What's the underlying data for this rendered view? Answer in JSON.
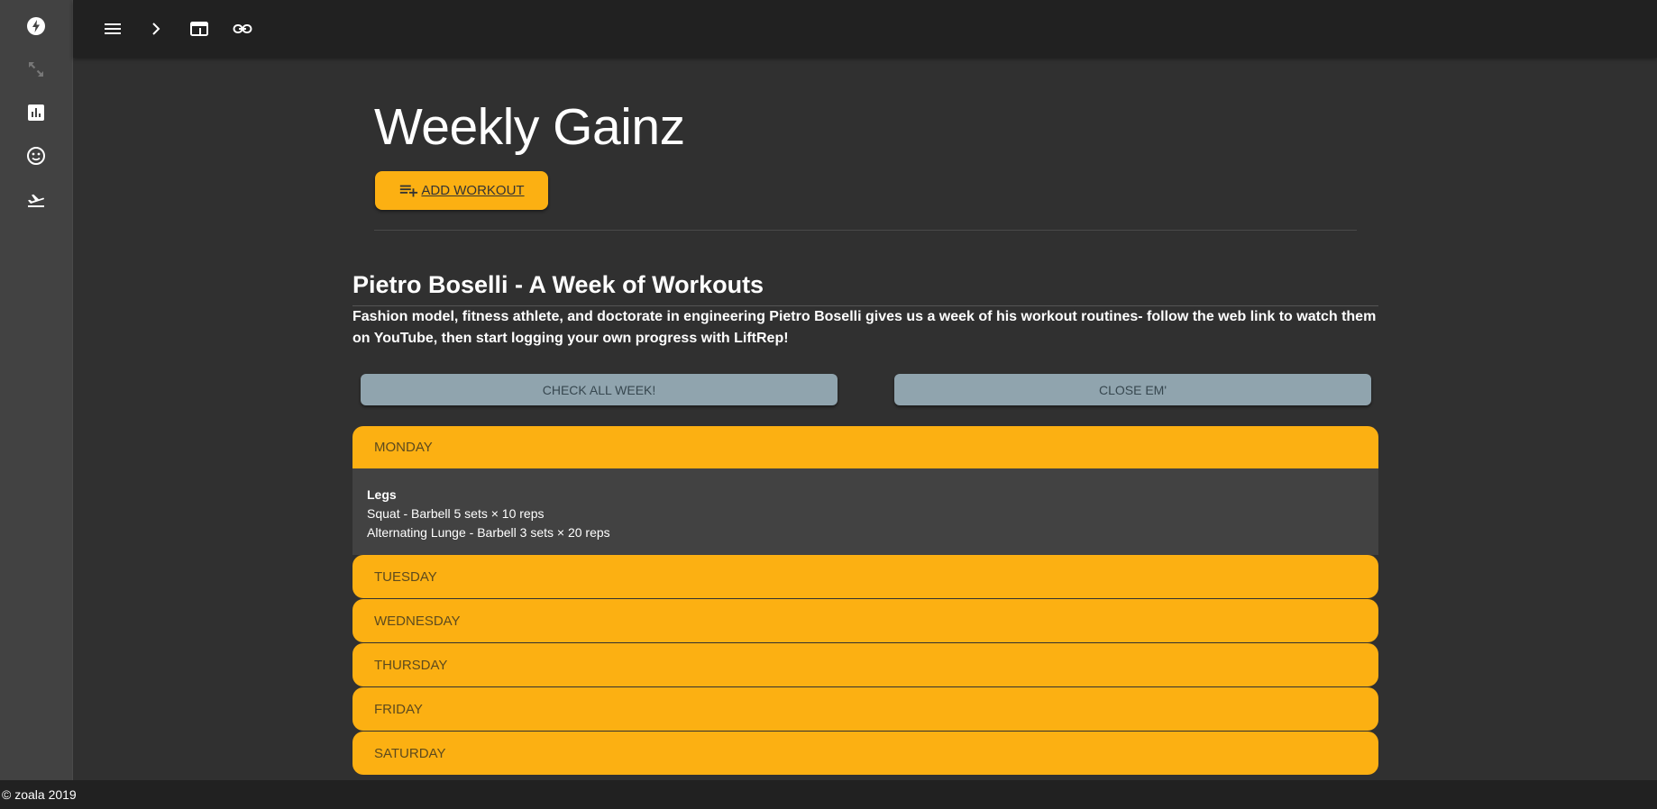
{
  "nav_rail": {
    "items": [
      {
        "icon": "flash-icon"
      },
      {
        "icon": "expand-arrows-icon"
      },
      {
        "icon": "bar-chart-icon"
      },
      {
        "icon": "smiley-icon"
      },
      {
        "icon": "airplane-takeoff-icon"
      }
    ]
  },
  "toolbar": {
    "items": [
      {
        "icon": "menu-icon"
      },
      {
        "icon": "chevron-right-icon"
      },
      {
        "icon": "web-window-icon"
      },
      {
        "icon": "link-icon"
      }
    ]
  },
  "hero": {
    "title": "Weekly Gainz",
    "add_button_label": "ADD WORKOUT",
    "add_button_icon": "playlist-add-icon"
  },
  "program": {
    "title": "Pietro Boselli - A Week of Workouts",
    "description": "Fashion model, fitness athlete, and doctorate in engineering Pietro Boselli gives us a week of his workout routines- follow the web link to watch them on YouTube, then start logging your own progress with LiftRep!",
    "check_all_label": "CHECK ALL WEEK!",
    "close_label": "CLOSE EM'"
  },
  "days": [
    {
      "name": "MONDAY",
      "expanded": true,
      "workout_title": "Legs",
      "exercises": [
        "Squat - Barbell 5 sets × 10 reps",
        "Alternating Lunge - Barbell 3 sets × 20 reps"
      ]
    },
    {
      "name": "TUESDAY",
      "expanded": false
    },
    {
      "name": "WEDNESDAY",
      "expanded": false
    },
    {
      "name": "THURSDAY",
      "expanded": false
    },
    {
      "name": "FRIDAY",
      "expanded": false
    },
    {
      "name": "SATURDAY",
      "expanded": false
    }
  ],
  "footer": {
    "text": "© zoala 2019"
  },
  "colors": {
    "accent": "#fcb012",
    "background": "#303030",
    "rail": "#424242",
    "topbar": "#212121",
    "secondary_button": "#90a4ae"
  }
}
